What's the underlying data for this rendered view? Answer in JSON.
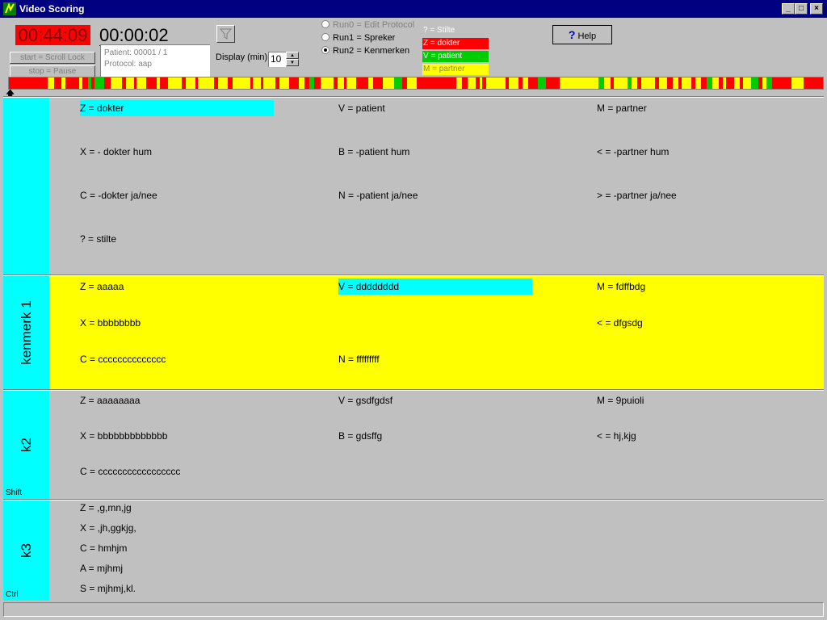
{
  "window": {
    "title": "Video Scoring",
    "minimize": "_",
    "maximize": "□",
    "close": "×"
  },
  "toolbar": {
    "elapsed_time": "00:44:09",
    "current_time": "00:00:02",
    "start_button": "start = Scroll Lock",
    "stop_button": "stop = Pause",
    "patient": "Patient: 00001 / 1",
    "protocol": "Protocol: aap",
    "display_label": "Display (min)",
    "display_value": "10",
    "radios": [
      {
        "label": "Run0 = Edit Protocol",
        "checked": false,
        "disabled": true
      },
      {
        "label": "Run1 = Spreker",
        "checked": false,
        "disabled": false
      },
      {
        "label": "Run2 = Kenmerken",
        "checked": true,
        "disabled": false
      }
    ],
    "legend": [
      {
        "label": "? = Stilte",
        "bg": "#c0c0c0",
        "fg": "#ffffff"
      },
      {
        "label": "Z = dokter",
        "bg": "#ff0000",
        "fg": "#ffffff"
      },
      {
        "label": "V = patient",
        "bg": "#00cc00",
        "fg": "#ffffff"
      },
      {
        "label": "M = partner",
        "bg": "#ffff00",
        "fg": "#808080"
      }
    ],
    "help_label": "Help",
    "help_icon": "question-mark-icon"
  },
  "colors": {
    "red": "#ff0000",
    "green": "#00cc00",
    "yellow": "#ffff00",
    "cyan": "#00ffff",
    "panel_grey": "#c0c0c0"
  },
  "panels": [
    {
      "label": "",
      "modifier": "",
      "bg": "#c0c0c0",
      "items": [
        {
          "text": "Z = dokter",
          "selected": true
        },
        {
          "text": "V = patient"
        },
        {
          "text": "M = partner"
        },
        {
          "text": "X = - dokter hum"
        },
        {
          "text": "B = -patient hum"
        },
        {
          "text": "< = -partner hum"
        },
        {
          "text": "C = -dokter ja/nee"
        },
        {
          "text": "N = -patient ja/nee"
        },
        {
          "text": "> = -partner ja/nee"
        },
        {
          "text": "? = stilte"
        }
      ]
    },
    {
      "label": "kenmerk 1",
      "modifier": "",
      "bg": "#ffff00",
      "items": [
        {
          "text": "Z = aaaaa"
        },
        {
          "text": "V = dddddddd",
          "selected": true
        },
        {
          "text": "M = fdffbdg"
        },
        {
          "text": "X = bbbbbbbb"
        },
        {
          "text": "< = dfgsdg"
        },
        {
          "text": "C = cccccccccccccc"
        },
        {
          "text": "N = fffffffff"
        }
      ]
    },
    {
      "label": "k2",
      "modifier": "Shift",
      "bg": "#c0c0c0",
      "items": [
        {
          "text": "Z = aaaaaaaa"
        },
        {
          "text": "V = gsdfgdsf"
        },
        {
          "text": "M = 9puioli"
        },
        {
          "text": "X = bbbbbbbbbbbbb"
        },
        {
          "text": "B = gdsffg"
        },
        {
          "text": "< = hj,kjg"
        },
        {
          "text": "C = ccccccccccccccccc"
        }
      ]
    },
    {
      "label": "k3",
      "modifier": "Ctrl",
      "bg": "#c0c0c0",
      "items": [
        {
          "text": "Z = ,g,mn,jg"
        },
        {
          "text": "X = ,jh,ggkjg,"
        },
        {
          "text": "C = hmhjm"
        },
        {
          "text": "A = mjhmj"
        },
        {
          "text": "S = mjhmj,kl."
        }
      ]
    }
  ]
}
